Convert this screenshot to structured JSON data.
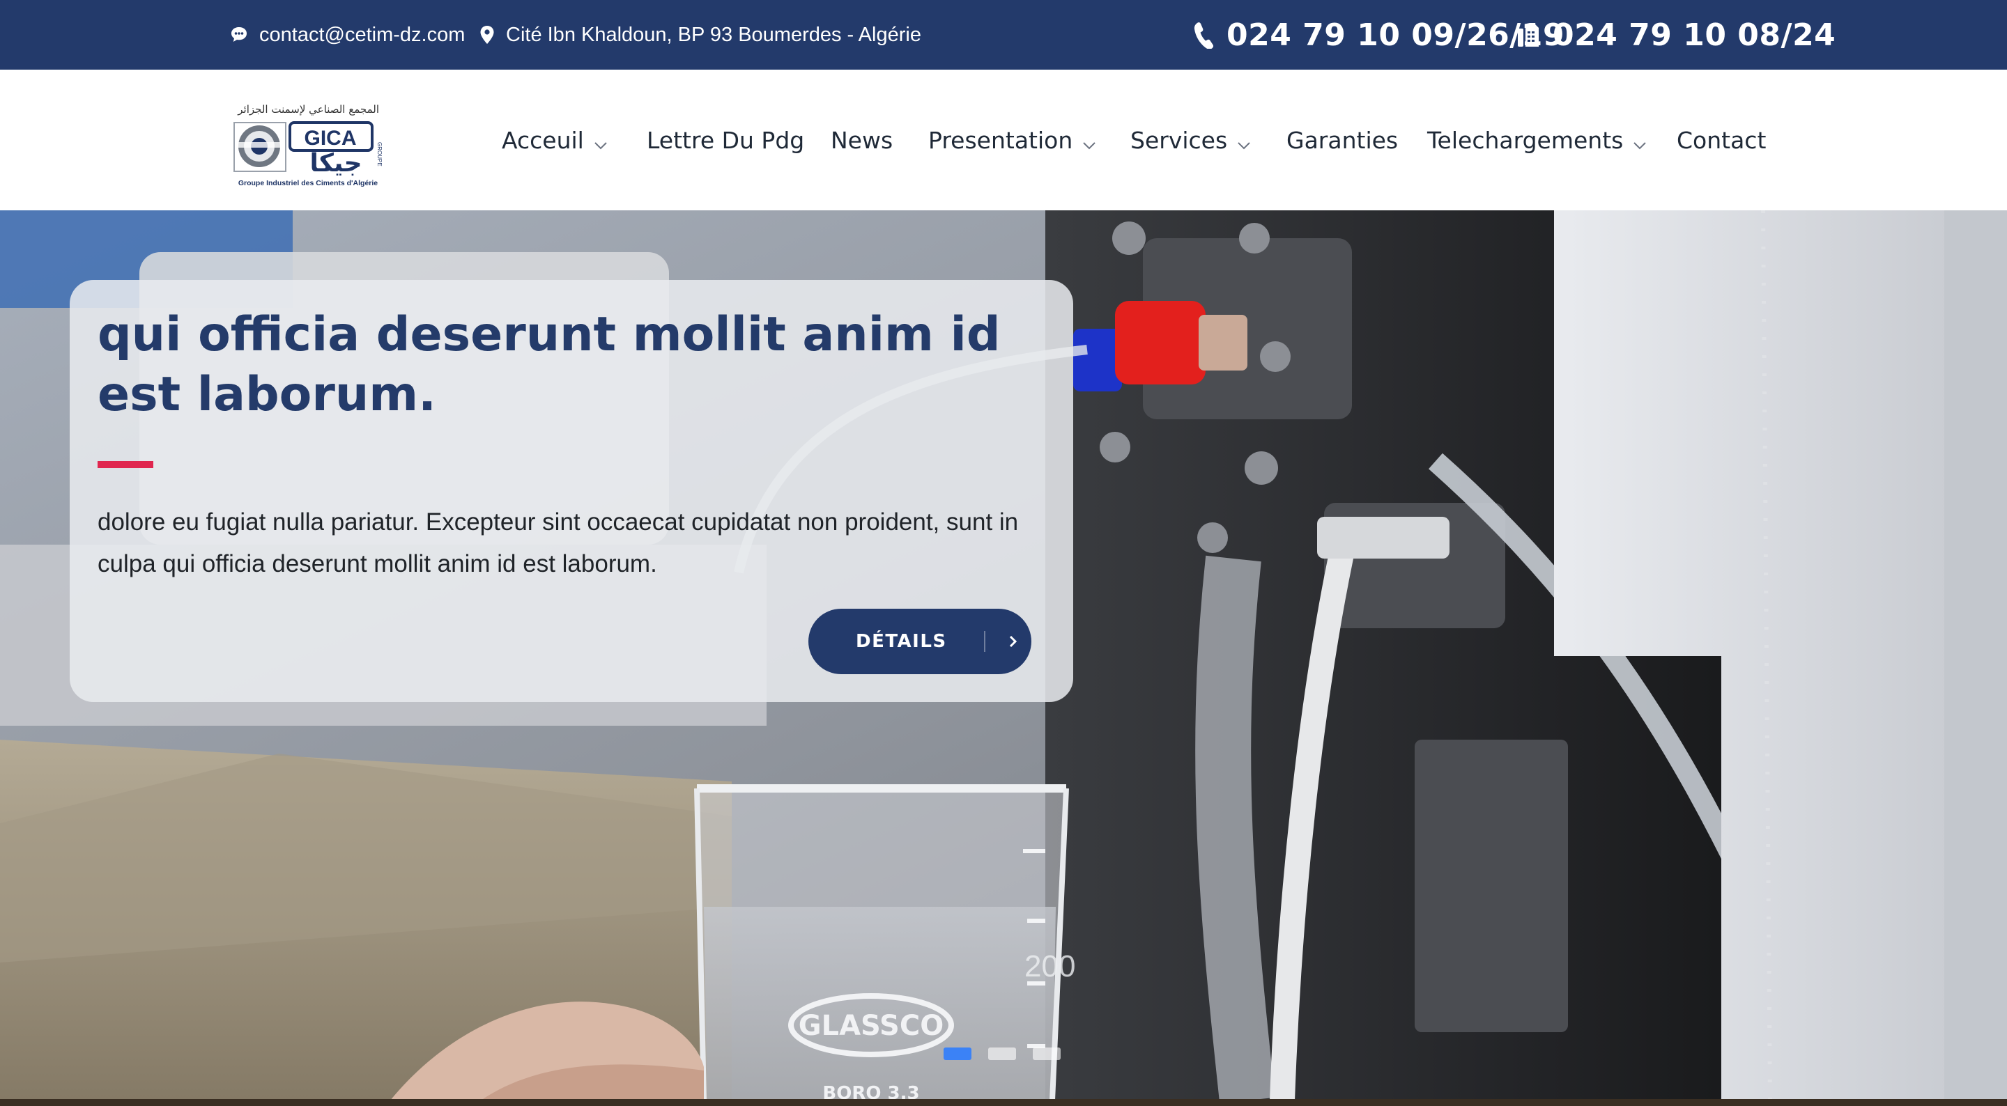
{
  "topbar": {
    "email": "contact@cetim-dz.com",
    "address": "Cité Ibn Khaldoun, BP 93 Boumerdes - Algérie",
    "phone": "024 79 10 09/26/19",
    "fax": "024 79 10 08/24"
  },
  "logo": {
    "arabic": "المجمع الصناعي لإسمنت الجزائر",
    "brand": "GICA",
    "arabic_brand": "جيكا",
    "group": "GROUPE",
    "tagline": "Groupe Industriel des Ciments d'Algérie"
  },
  "nav": {
    "acceuil": "Acceuil",
    "pdg": "Lettre Du Pdg",
    "news": "News",
    "presentation": "Presentation",
    "services": "Services",
    "garanties": "Garanties",
    "telechargements": "Telechargements",
    "contact": "Contact"
  },
  "hero": {
    "title": "qui officia deserunt mollit anim id est laborum.",
    "text": "dolore eu fugiat nulla pariatur. Excepteur sint occaecat cupidatat non proident, sunt in culpa qui officia deserunt mollit anim id est laborum.",
    "button": "DÉTAILS",
    "beaker_brand": "GLASSCO",
    "beaker_material": "BORO 3.3",
    "slides_total": 3,
    "slide_active": 1
  },
  "colors": {
    "primary": "#233a6b",
    "accent": "#e0264f",
    "dot_active": "#3b82f6"
  }
}
